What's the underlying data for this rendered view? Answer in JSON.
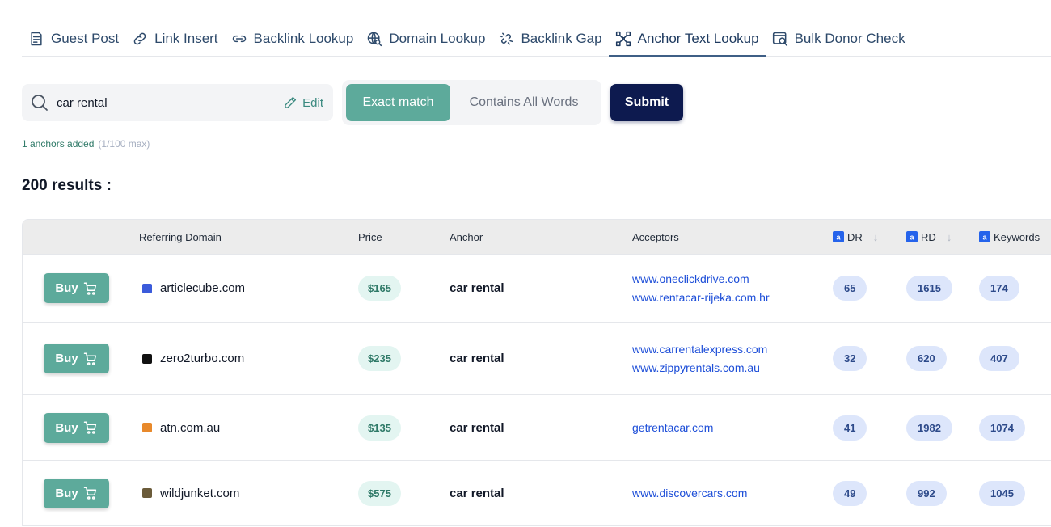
{
  "tabs": [
    {
      "label": "Guest Post",
      "icon": "document-icon",
      "active": false
    },
    {
      "label": "Link Insert",
      "icon": "link-icon",
      "active": false
    },
    {
      "label": "Backlink Lookup",
      "icon": "chain-link-icon",
      "active": false
    },
    {
      "label": "Domain Lookup",
      "icon": "globe-search-icon",
      "active": false
    },
    {
      "label": "Backlink Gap",
      "icon": "broken-link-icon",
      "active": false
    },
    {
      "label": "Anchor Text Lookup",
      "icon": "anchor-nodes-icon",
      "active": true
    },
    {
      "label": "Bulk Donor Check",
      "icon": "browser-search-icon",
      "active": false
    }
  ],
  "search": {
    "value": "car rental",
    "edit_label": "Edit"
  },
  "match": {
    "exact_label": "Exact match",
    "contains_label": "Contains All Words",
    "selected": "exact"
  },
  "submit_label": "Submit",
  "anchors_note": {
    "count_text": "1 anchors added",
    "max_text": "(1/100 max)"
  },
  "results_label": "200 results :",
  "table": {
    "headers": {
      "domain": "Referring Domain",
      "price": "Price",
      "anchor": "Anchor",
      "acceptors": "Acceptors",
      "dr": "DR",
      "rd": "RD",
      "keywords": "Keywords"
    },
    "buy_label": "Buy",
    "rows": [
      {
        "domain": "articlecube.com",
        "favicon_color": "#3b5bdb",
        "price": "$165",
        "anchor": "car rental",
        "acceptors": [
          "www.oneclickdrive.com",
          "www.rentacar-rijeka.com.hr"
        ],
        "dr": "65",
        "rd": "1615",
        "keywords": "174"
      },
      {
        "domain": "zero2turbo.com",
        "favicon_color": "#111111",
        "price": "$235",
        "anchor": "car rental",
        "acceptors": [
          "www.carrentalexpress.com",
          "www.zippyrentals.com.au"
        ],
        "dr": "32",
        "rd": "620",
        "keywords": "407"
      },
      {
        "domain": "atn.com.au",
        "favicon_color": "#e8892b",
        "price": "$135",
        "anchor": "car rental",
        "acceptors": [
          "getrentacar.com"
        ],
        "dr": "41",
        "rd": "1982",
        "keywords": "1074"
      },
      {
        "domain": "wildjunket.com",
        "favicon_color": "#6b5b3a",
        "price": "$575",
        "anchor": "car rental",
        "acceptors": [
          "www.discovercars.com"
        ],
        "dr": "49",
        "rd": "992",
        "keywords": "1045"
      }
    ]
  },
  "colors": {
    "accent_teal": "#5daa9b",
    "submit_navy": "#0d1a4f",
    "tab_text": "#2e4a6b",
    "link_blue": "#1d4ed8"
  }
}
